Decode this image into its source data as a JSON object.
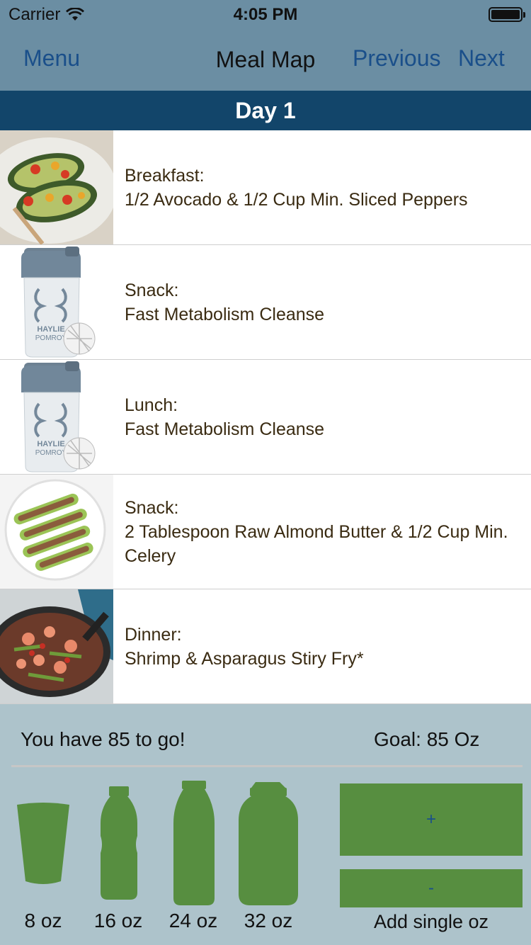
{
  "status_bar": {
    "carrier": "Carrier",
    "time": "4:05 PM"
  },
  "nav": {
    "menu_label": "Menu",
    "title": "Meal Map",
    "previous_label": "Previous",
    "next_label": "Next"
  },
  "day": {
    "title": "Day 1"
  },
  "meals": [
    {
      "label": "Breakfast:",
      "description": "1/2 Avocado & 1/2 Cup Min. Sliced Peppers",
      "image": "stuffed-avocado-photo"
    },
    {
      "label": "Snack:",
      "description": "Fast Metabolism Cleanse",
      "image": "shaker-bottle-photo",
      "brand_line1": "HAYLIE",
      "brand_line2": "POMROY"
    },
    {
      "label": "Lunch:",
      "description": "Fast Metabolism Cleanse",
      "image": "shaker-bottle-photo",
      "brand_line1": "HAYLIE",
      "brand_line2": "POMROY"
    },
    {
      "label": "Snack:",
      "description": "2 Tablespoon Raw Almond Butter & 1/2 Cup Min. Celery",
      "image": "celery-almond-butter-photo"
    },
    {
      "label": "Dinner:",
      "description": "Shrimp & Asparagus Stiry Fry*",
      "image": "shrimp-stir-fry-photo"
    }
  ],
  "water": {
    "remaining_text": "You have 85 to go!",
    "goal_text": "Goal: 85 Oz",
    "containers": [
      {
        "label": "8 oz",
        "icon": "glass-icon"
      },
      {
        "label": "16 oz",
        "icon": "small-bottle-icon"
      },
      {
        "label": "24 oz",
        "icon": "bottle-icon"
      },
      {
        "label": "32 oz",
        "icon": "jug-icon"
      }
    ],
    "plus_label": "+",
    "minus_label": "-",
    "single_label": "Add single oz"
  },
  "colors": {
    "nav_bg": "#6b8ea3",
    "day_header_bg": "#12456a",
    "link_blue": "#1a4f8a",
    "water_bg": "#adc3cb",
    "button_green": "#578e40",
    "meal_text": "#3a2b12"
  }
}
